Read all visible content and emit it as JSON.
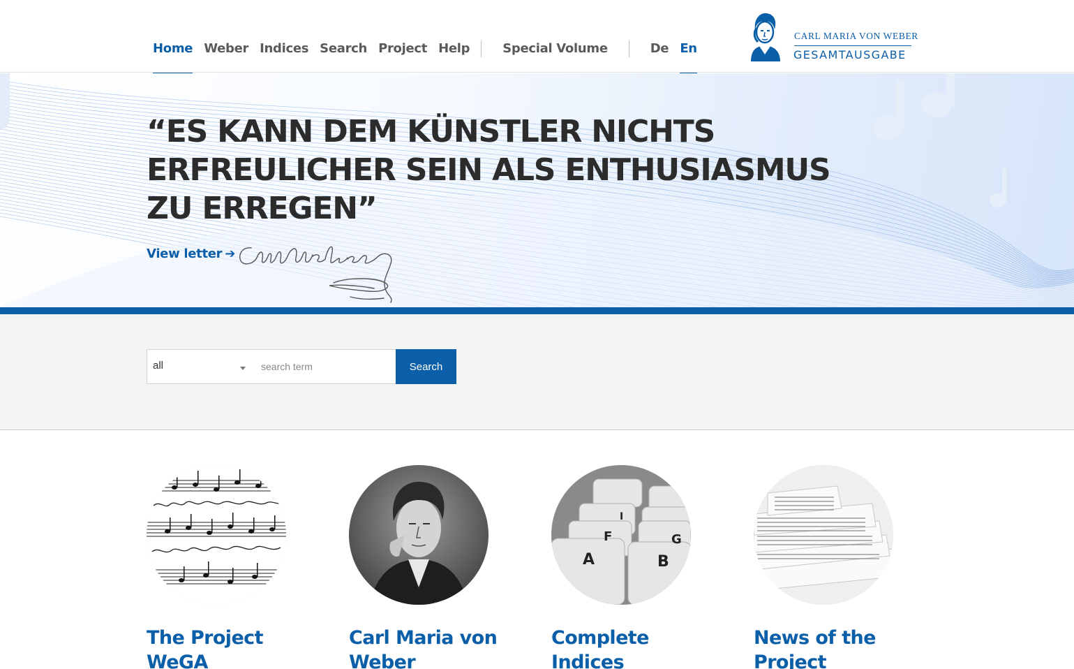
{
  "nav": {
    "items": [
      {
        "label": "Home",
        "active": true
      },
      {
        "label": "Weber"
      },
      {
        "label": "Indices"
      },
      {
        "label": "Search"
      },
      {
        "label": "Project"
      },
      {
        "label": "Help"
      }
    ],
    "special": "Special Volume",
    "languages": [
      {
        "label": "De"
      },
      {
        "label": "En",
        "active": true
      }
    ]
  },
  "logo": {
    "line1": "CARL MARIA VON WEBER",
    "line2": "GESAMTAUSGABE"
  },
  "hero": {
    "quote": "“Es kann dem Künstler nichts erfreulicher sein als Enthusiasmus zu erregen”",
    "view_letter": "View letter",
    "arrow_icon": "arrow-right-icon"
  },
  "search": {
    "scope_value": "all",
    "placeholder": "search term",
    "button_label": "Search"
  },
  "cards": [
    {
      "title": "The Project WeGA",
      "image": "sheet-music-image"
    },
    {
      "title": "Carl Maria von Weber",
      "image": "weber-portrait-image"
    },
    {
      "title": "Complete Indices",
      "image": "index-cards-image"
    },
    {
      "title": "News of the Project",
      "image": "newspapers-image"
    }
  ],
  "colors": {
    "brand": "#0b5ea8",
    "nav_text": "#5a5a5a",
    "quote_text": "#2c2c2c",
    "search_band": "#f4f4f4"
  }
}
